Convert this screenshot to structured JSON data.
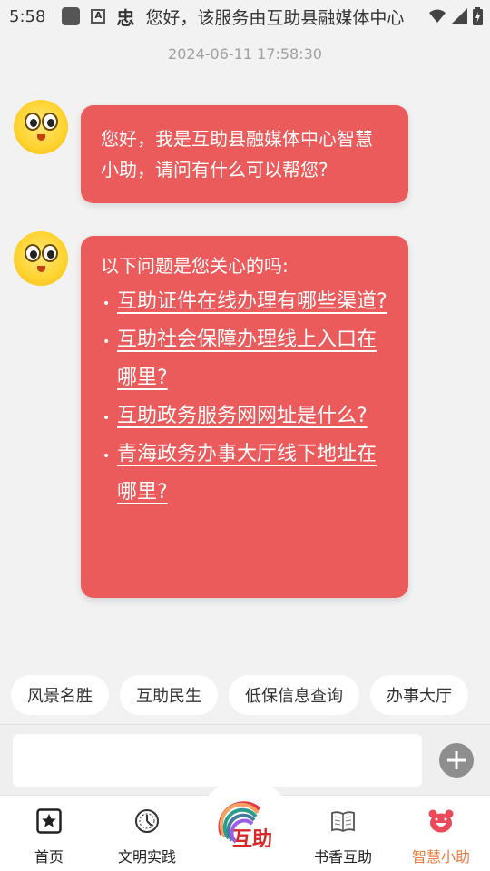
{
  "status_bar": {
    "time": "5:58",
    "notification_text": "您好，该服务由互助县融媒体中心",
    "icons": [
      "square-icon",
      "a-icon",
      "ghost-icon",
      "wifi-icon",
      "signal-icon",
      "battery-icon"
    ]
  },
  "chat": {
    "timestamp": "2024-06-11 17:58:30",
    "messages": [
      {
        "sender": "bot",
        "text": "您好，我是互助县融媒体中心智慧小助，请问有什么可以帮您?"
      },
      {
        "sender": "bot",
        "title": "以下问题是您关心的吗:",
        "questions": [
          "互助证件在线办理有哪些渠道? ",
          "互助社会保障办理线上入口在哪里? ",
          "互助政务服务网网址是什么? ",
          "青海政务办事大厅线下地址在哪里? "
        ]
      }
    ]
  },
  "quick_chips": [
    "风景名胜",
    "互助民生",
    "低保信息查询",
    "办事大厅"
  ],
  "input": {
    "placeholder": ""
  },
  "tabbar": {
    "tabs": [
      {
        "label": "首页",
        "icon": "star-box-icon"
      },
      {
        "label": "文明实践",
        "icon": "gauge-icon"
      },
      {
        "label": "",
        "icon": "huzhu-logo"
      },
      {
        "label": "书香互助",
        "icon": "book-icon"
      },
      {
        "label": "智慧小助",
        "icon": "bear-icon",
        "active": true
      }
    ],
    "center_logo_text": "互助"
  },
  "colors": {
    "bubble": "#ec5b5b",
    "accent": "#f07b3c",
    "background": "#f2f2f2"
  }
}
